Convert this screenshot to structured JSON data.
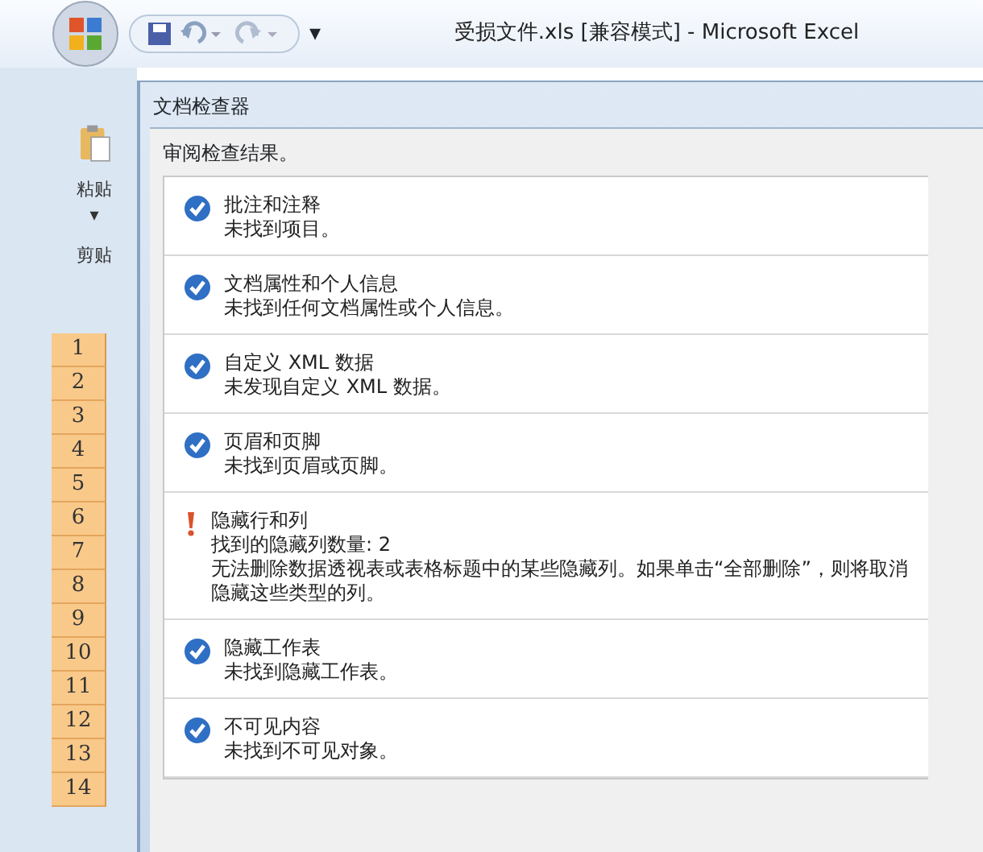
{
  "window": {
    "title": "受损文件.xls  [兼容模式] - Microsoft Excel",
    "quick_access": [
      "▾"
    ]
  },
  "ribbon": {
    "paste_label": "粘贴",
    "paste_caret": "▾",
    "group_label": "剪贴"
  },
  "sheet": {
    "row_headers": [
      "1",
      "2",
      "3",
      "4",
      "5",
      "6",
      "7",
      "8",
      "9",
      "10",
      "11",
      "12",
      "13",
      "14"
    ]
  },
  "dialog": {
    "title": "文档检查器",
    "heading": "审阅检查结果。",
    "results": [
      {
        "kind": "ok",
        "title": "批注和注释",
        "lines": [
          "未找到项目。"
        ]
      },
      {
        "kind": "ok",
        "title": "文档属性和个人信息",
        "lines": [
          "未找到任何文档属性或个人信息。"
        ]
      },
      {
        "kind": "ok",
        "title": "自定义 XML 数据",
        "lines": [
          "未发现自定义 XML 数据。"
        ]
      },
      {
        "kind": "ok",
        "title": "页眉和页脚",
        "lines": [
          "未找到页眉或页脚。"
        ]
      },
      {
        "kind": "issue",
        "title": "隐藏行和列",
        "lines": [
          "找到的隐藏列数量: 2",
          "无法删除数据透视表或表格标题中的某些隐藏列。如果单击“全部删除”，则将取消隐藏这些类型的列。"
        ]
      },
      {
        "kind": "ok",
        "title": "隐藏工作表",
        "lines": [
          "未找到隐藏工作表。"
        ]
      },
      {
        "kind": "ok",
        "title": "不可见内容",
        "lines": [
          "未找到不可见对象。"
        ]
      }
    ]
  }
}
